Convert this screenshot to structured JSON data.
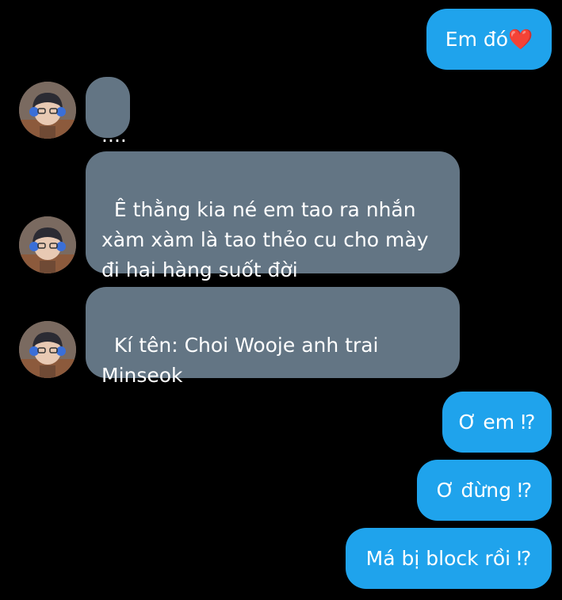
{
  "messages": [
    {
      "id": "m1",
      "direction": "outgoing",
      "text": "Em đó❤️"
    },
    {
      "id": "m2",
      "direction": "incoming",
      "text": "...."
    },
    {
      "id": "m3",
      "direction": "incoming",
      "text": "Ê thằng kia né em tao ra nhắn xàm xàm là tao thẻo cu cho mày đi hai hàng suốt đời"
    },
    {
      "id": "m4",
      "direction": "incoming",
      "text": "Kí tên: Choi Wooje anh trai Minseok"
    },
    {
      "id": "m5",
      "direction": "outgoing",
      "text": "Ơ em ⁉"
    },
    {
      "id": "m6",
      "direction": "outgoing",
      "text": "Ơ đừng ⁉"
    },
    {
      "id": "m7",
      "direction": "outgoing",
      "text": "Má bị block rồi ⁉"
    }
  ],
  "colors": {
    "background": "#000000",
    "outgoing_bubble": "#1fa3ec",
    "incoming_bubble": "#637584",
    "text": "#ffffff"
  },
  "icons": {
    "avatar": "contact-photo"
  }
}
